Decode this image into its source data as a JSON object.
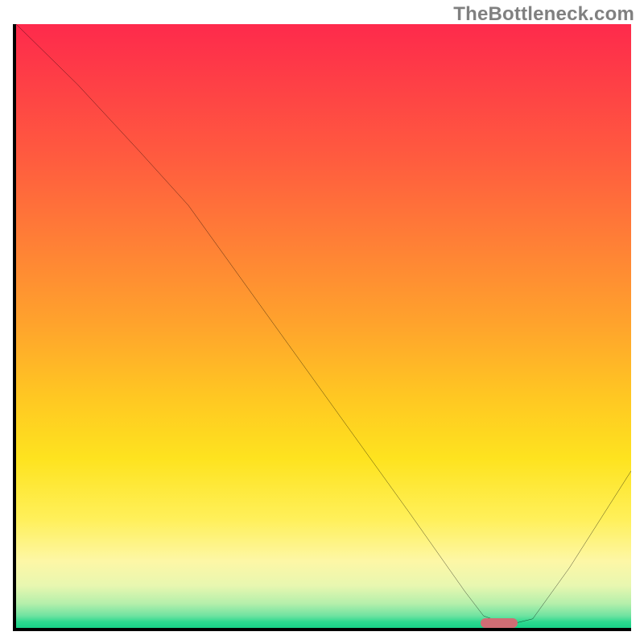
{
  "watermark": "TheBottleneck.com",
  "chart_data": {
    "type": "line",
    "title": "",
    "xlabel": "",
    "ylabel": "",
    "xlim": [
      0,
      100
    ],
    "ylim": [
      0,
      100
    ],
    "grid": false,
    "legend": false,
    "background": {
      "type": "vertical-gradient",
      "stops": [
        {
          "pos": 0,
          "color": "#fe2a4c"
        },
        {
          "pos": 22,
          "color": "#ff5b3f"
        },
        {
          "pos": 50,
          "color": "#ffa42c"
        },
        {
          "pos": 72,
          "color": "#fee31f"
        },
        {
          "pos": 89,
          "color": "#fdf7a6"
        },
        {
          "pos": 96,
          "color": "#b4efab"
        },
        {
          "pos": 100,
          "color": "#18d288"
        }
      ]
    },
    "series": [
      {
        "name": "bottleneck-curve",
        "color": "#000000",
        "x": [
          0,
          10,
          20,
          28,
          40,
          52,
          64,
          73,
          76,
          80,
          84,
          90,
          95,
          100
        ],
        "y": [
          100,
          90,
          79,
          70,
          53,
          36,
          19,
          6,
          2,
          0.5,
          1.5,
          10,
          18,
          26
        ]
      }
    ],
    "marker": {
      "name": "optimal-point",
      "x": 78.5,
      "y": 0.8,
      "width_pct": 6.0,
      "height_pct": 1.6,
      "color": "#cf6d74"
    }
  }
}
